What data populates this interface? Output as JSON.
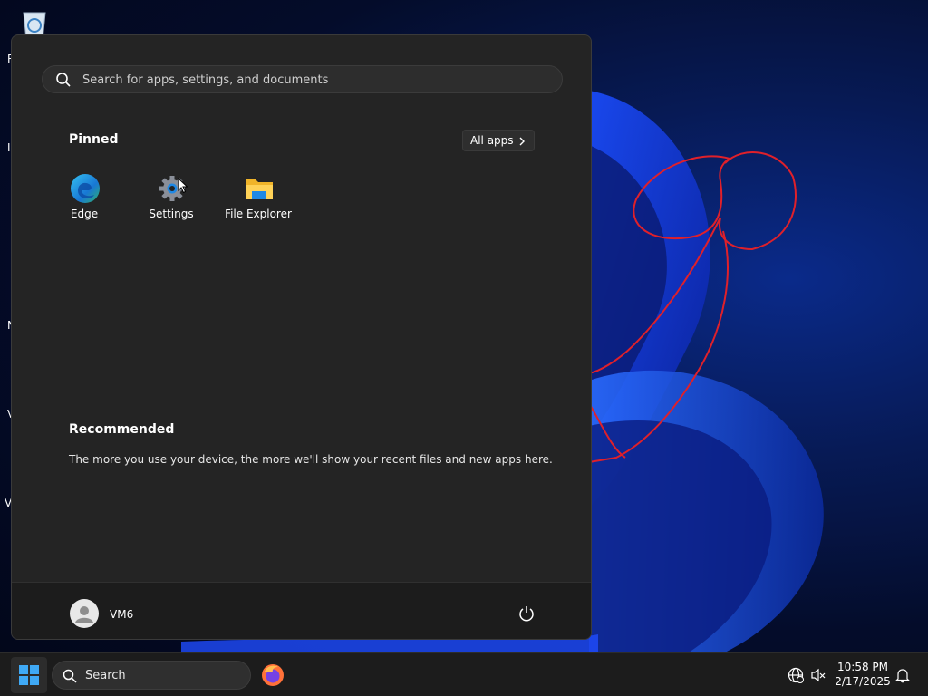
{
  "desktop": {
    "edge_letters": [
      "R",
      "I",
      "N",
      "V",
      "V"
    ]
  },
  "start_menu": {
    "search": {
      "placeholder": "Search for apps, settings, and documents"
    },
    "pinned": {
      "title": "Pinned",
      "all_apps_label": "All apps",
      "apps": [
        {
          "label": "Edge",
          "icon": "edge-icon"
        },
        {
          "label": "Settings",
          "icon": "settings-gear-icon"
        },
        {
          "label": "File Explorer",
          "icon": "folder-icon"
        }
      ]
    },
    "recommended": {
      "title": "Recommended",
      "message": "The more you use your device, the more we'll show your recent files and new apps here."
    },
    "user": {
      "name": "VM6"
    }
  },
  "taskbar": {
    "search_label": "Search",
    "time": "10:58 PM",
    "date": "2/17/2025"
  },
  "colors": {
    "menu_bg": "#242424",
    "footer_bg": "#1c1c1c",
    "taskbar_bg": "#1c1c1c",
    "accent": "#0078d4",
    "annotation": "#e0202a"
  }
}
